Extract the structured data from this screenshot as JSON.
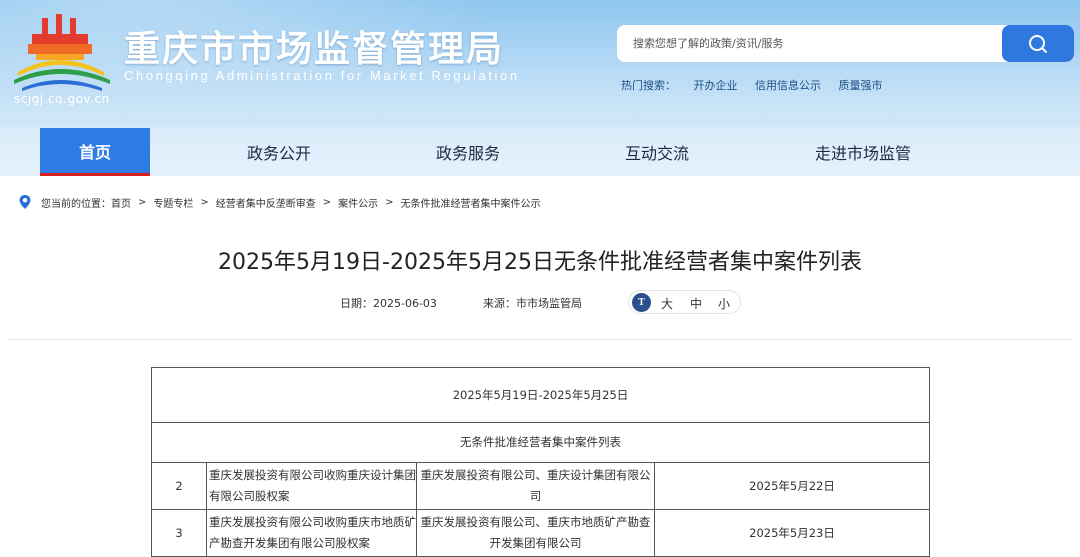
{
  "header": {
    "site_title": "重庆市市场监督管理局",
    "site_subtitle": "Chongqing  Administration for Market Regulation",
    "site_domain": "scjgj.cq.gov.cn",
    "search_placeholder": "搜索您想了解的政策/资讯/服务",
    "hot_search_label": "热门搜索：",
    "hot_search_items": [
      "开办企业",
      "信用信息公示",
      "质量强市"
    ]
  },
  "nav": {
    "items": [
      "首页",
      "政务公开",
      "政务服务",
      "互动交流",
      "走进市场监管"
    ],
    "active_index": 0
  },
  "breadcrumb": {
    "prefix": "您当前的位置：",
    "items": [
      "首页",
      "专题专栏",
      "经营者集中反垄断审查",
      "案件公示",
      "无条件批准经营者集中案件公示"
    ],
    "separator": ">"
  },
  "article": {
    "title": "2025年5月19日-2025年5月25日无条件批准经营者集中案件列表",
    "date": "日期：2025-06-03",
    "source": "来源：市市场监管局",
    "font_icon_text": "T",
    "font_sizes": [
      "大",
      "中",
      "小"
    ]
  },
  "table": {
    "period": "2025年5月19日-2025年5月25日",
    "subtitle": "无条件批准经营者集中案件列表",
    "rows": [
      {
        "no": "2",
        "case": "重庆发展投资有限公司收购重庆设计集团有限公司股权案",
        "parties": "重庆发展投资有限公司、重庆设计集团有限公司",
        "date": "2025年5月22日"
      },
      {
        "no": "3",
        "case": "重庆发展投资有限公司收购重庆市地质矿产勘查开发集团有限公司股权案",
        "parties": "重庆发展投资有限公司、重庆市地质矿产勘查开发集团有限公司",
        "date": "2025年5月23日"
      }
    ]
  },
  "colors": {
    "nav_active": "#2d7ce6",
    "nav_active_underline": "#d71f22",
    "search_button": "#2f78e0",
    "header_sky": "#8ec5ef"
  },
  "icons": {
    "search": "search-icon",
    "location": "location-pin-icon",
    "font": "font-size-icon",
    "logo": "emblem-logo-icon"
  }
}
